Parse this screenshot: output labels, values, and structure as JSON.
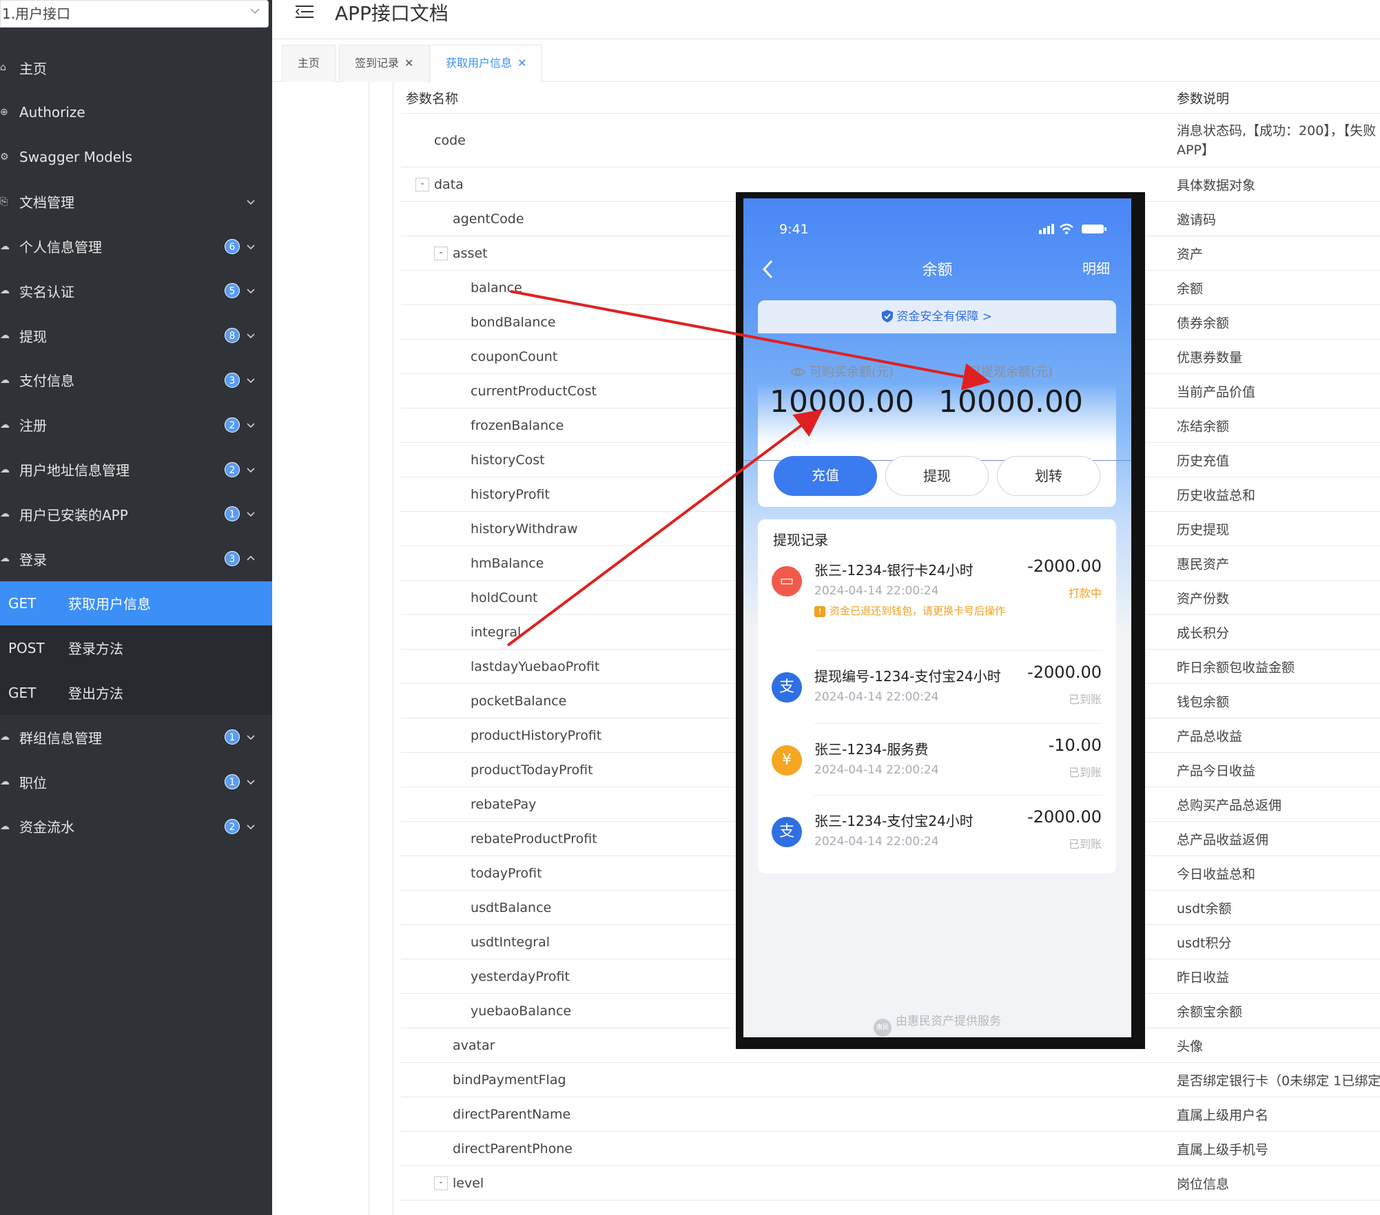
{
  "app": {
    "group_select": "1.用户接口",
    "title": "APP接口文档"
  },
  "sidebar": {
    "items": [
      {
        "label": "主页",
        "icon": "home-icon"
      },
      {
        "label": "Authorize",
        "icon": "lock-icon"
      },
      {
        "label": "Swagger Models",
        "icon": "models-icon"
      },
      {
        "label": "文档管理",
        "icon": "doc-icon",
        "arrow": "down"
      },
      {
        "label": "个人信息管理",
        "icon": "cloud-icon",
        "badge": "6",
        "arrow": "down"
      },
      {
        "label": "实名认证",
        "icon": "cloud-icon",
        "badge": "5",
        "arrow": "down"
      },
      {
        "label": "提现",
        "icon": "cloud-icon",
        "badge": "8",
        "arrow": "down"
      },
      {
        "label": "支付信息",
        "icon": "cloud-icon",
        "badge": "3",
        "arrow": "down"
      },
      {
        "label": "注册",
        "icon": "cloud-icon",
        "badge": "2",
        "arrow": "down"
      },
      {
        "label": "用户地址信息管理",
        "icon": "cloud-icon",
        "badge": "2",
        "arrow": "down"
      },
      {
        "label": "用户已安装的APP",
        "icon": "cloud-icon",
        "badge": "1",
        "arrow": "down"
      },
      {
        "label": "登录",
        "icon": "cloud-icon",
        "badge": "3",
        "arrow": "up"
      }
    ],
    "login_children": [
      {
        "method": "GET",
        "label": "获取用户信息",
        "active": true
      },
      {
        "method": "POST",
        "label": "登录方法",
        "active": false
      },
      {
        "method": "GET",
        "label": "登出方法",
        "active": false
      }
    ],
    "items_after": [
      {
        "label": "群组信息管理",
        "icon": "cloud-icon",
        "badge": "1",
        "arrow": "down"
      },
      {
        "label": "职位",
        "icon": "cloud-icon",
        "badge": "1",
        "arrow": "down"
      },
      {
        "label": "资金流水",
        "icon": "cloud-icon",
        "badge": "2",
        "arrow": "down"
      }
    ]
  },
  "tabs": [
    {
      "label": "主页",
      "closable": false,
      "active": false
    },
    {
      "label": "签到记录",
      "closable": true,
      "active": false
    },
    {
      "label": "获取用户信息",
      "closable": true,
      "active": true
    }
  ],
  "params": {
    "header": {
      "name": "参数名称",
      "desc": "参数说明"
    },
    "rows": [
      {
        "name": "code",
        "desc": "消息状态码,【成功：200】，【失败",
        "desc2": "APP】",
        "level": 1
      },
      {
        "name": "data",
        "desc": "具体数据对象",
        "level": 1,
        "toggle": "-"
      },
      {
        "name": "agentCode",
        "desc": "邀请码",
        "level": 2
      },
      {
        "name": "asset",
        "desc": "资产",
        "level": 2,
        "toggle": "-"
      },
      {
        "name": "balance",
        "desc": "余额",
        "level": 3
      },
      {
        "name": "bondBalance",
        "desc": "债券余额",
        "level": 3
      },
      {
        "name": "couponCount",
        "desc": "优惠券数量",
        "level": 3
      },
      {
        "name": "currentProductCost",
        "desc": "当前产品价值",
        "level": 3
      },
      {
        "name": "frozenBalance",
        "desc": "冻结余额",
        "level": 3
      },
      {
        "name": "historyCost",
        "desc": "历史充值",
        "level": 3
      },
      {
        "name": "historyProfit",
        "desc": "历史收益总和",
        "level": 3
      },
      {
        "name": "historyWithdraw",
        "desc": "历史提现",
        "level": 3
      },
      {
        "name": "hmBalance",
        "desc": "惠民资产",
        "level": 3
      },
      {
        "name": "holdCount",
        "desc": "资产份数",
        "level": 3
      },
      {
        "name": "integral",
        "desc": "成长积分",
        "level": 3
      },
      {
        "name": "lastdayYuebaoProfit",
        "desc": "昨日余额包收益金额",
        "level": 3
      },
      {
        "name": "pocketBalance",
        "desc": "钱包余额",
        "level": 3
      },
      {
        "name": "productHistoryProfit",
        "desc": "产品总收益",
        "level": 3
      },
      {
        "name": "productTodayProfit",
        "desc": "产品今日收益",
        "level": 3
      },
      {
        "name": "rebatePay",
        "desc": "总购买产品总返佣",
        "level": 3
      },
      {
        "name": "rebateProductProfit",
        "desc": "总产品收益返佣",
        "level": 3
      },
      {
        "name": "todayProfit",
        "desc": "今日收益总和",
        "level": 3
      },
      {
        "name": "usdtBalance",
        "desc": "usdt余额",
        "level": 3
      },
      {
        "name": "usdtIntegral",
        "desc": "usdt积分",
        "level": 3
      },
      {
        "name": "yesterdayProfit",
        "desc": "昨日收益",
        "level": 3
      },
      {
        "name": "yuebaoBalance",
        "desc": "余额宝余额",
        "level": 3
      },
      {
        "name": "avatar",
        "desc": "头像",
        "level": 2
      },
      {
        "name": "bindPaymentFlag",
        "desc": "是否绑定银行卡（0未绑定 1已绑定",
        "level": 2
      },
      {
        "name": "directParentName",
        "desc": "直属上级用户名",
        "level": 2
      },
      {
        "name": "directParentPhone",
        "desc": "直属上级手机号",
        "level": 2
      },
      {
        "name": "level",
        "desc": "岗位信息",
        "level": 2,
        "toggle": "-"
      }
    ]
  },
  "phone": {
    "time": "9:41",
    "nav_title": "余额",
    "nav_right": "明细",
    "safety": "资金安全有保障 >",
    "buy_caption": "可购买余额(元)",
    "buy_amount": "10000.00",
    "withdraw_caption": "可提现余额(元)",
    "withdraw_amount": "10000.00",
    "buttons": {
      "recharge": "充值",
      "withdraw": "提现",
      "transfer": "划转"
    },
    "records_title": "提现记录",
    "records": [
      {
        "name": "张三-1234-银行卡24小时",
        "time": "2024-04-14 22:00:24",
        "amount": "-2000.00",
        "status": "打款中",
        "note": "资金已退还到钱包，请更换卡号后操作",
        "icon": "bank-card-icon",
        "color": "#f15a4a"
      },
      {
        "name": "提现编号-1234-支付宝24小时",
        "time": "2024-04-14 22:00:24",
        "amount": "-2000.00",
        "status": "已到账",
        "icon": "alipay-icon",
        "color": "#2f6fe4"
      },
      {
        "name": "张三-1234-服务费",
        "time": "2024-04-14 22:00:24",
        "amount": "-10.00",
        "status": "已到账",
        "icon": "yuan-icon",
        "color": "#f5a623"
      },
      {
        "name": "张三-1234-支付宝24小时",
        "time": "2024-04-14 22:00:24",
        "amount": "-2000.00",
        "status": "已到账",
        "icon": "alipay-icon",
        "color": "#2f6fe4"
      }
    ],
    "footer": "由惠民资产提供服务",
    "footer_logo": "惠民"
  },
  "colors": {
    "sidebar_bg": "#2f3338",
    "accent": "#3b8ff7",
    "arrow": "#e02020"
  }
}
